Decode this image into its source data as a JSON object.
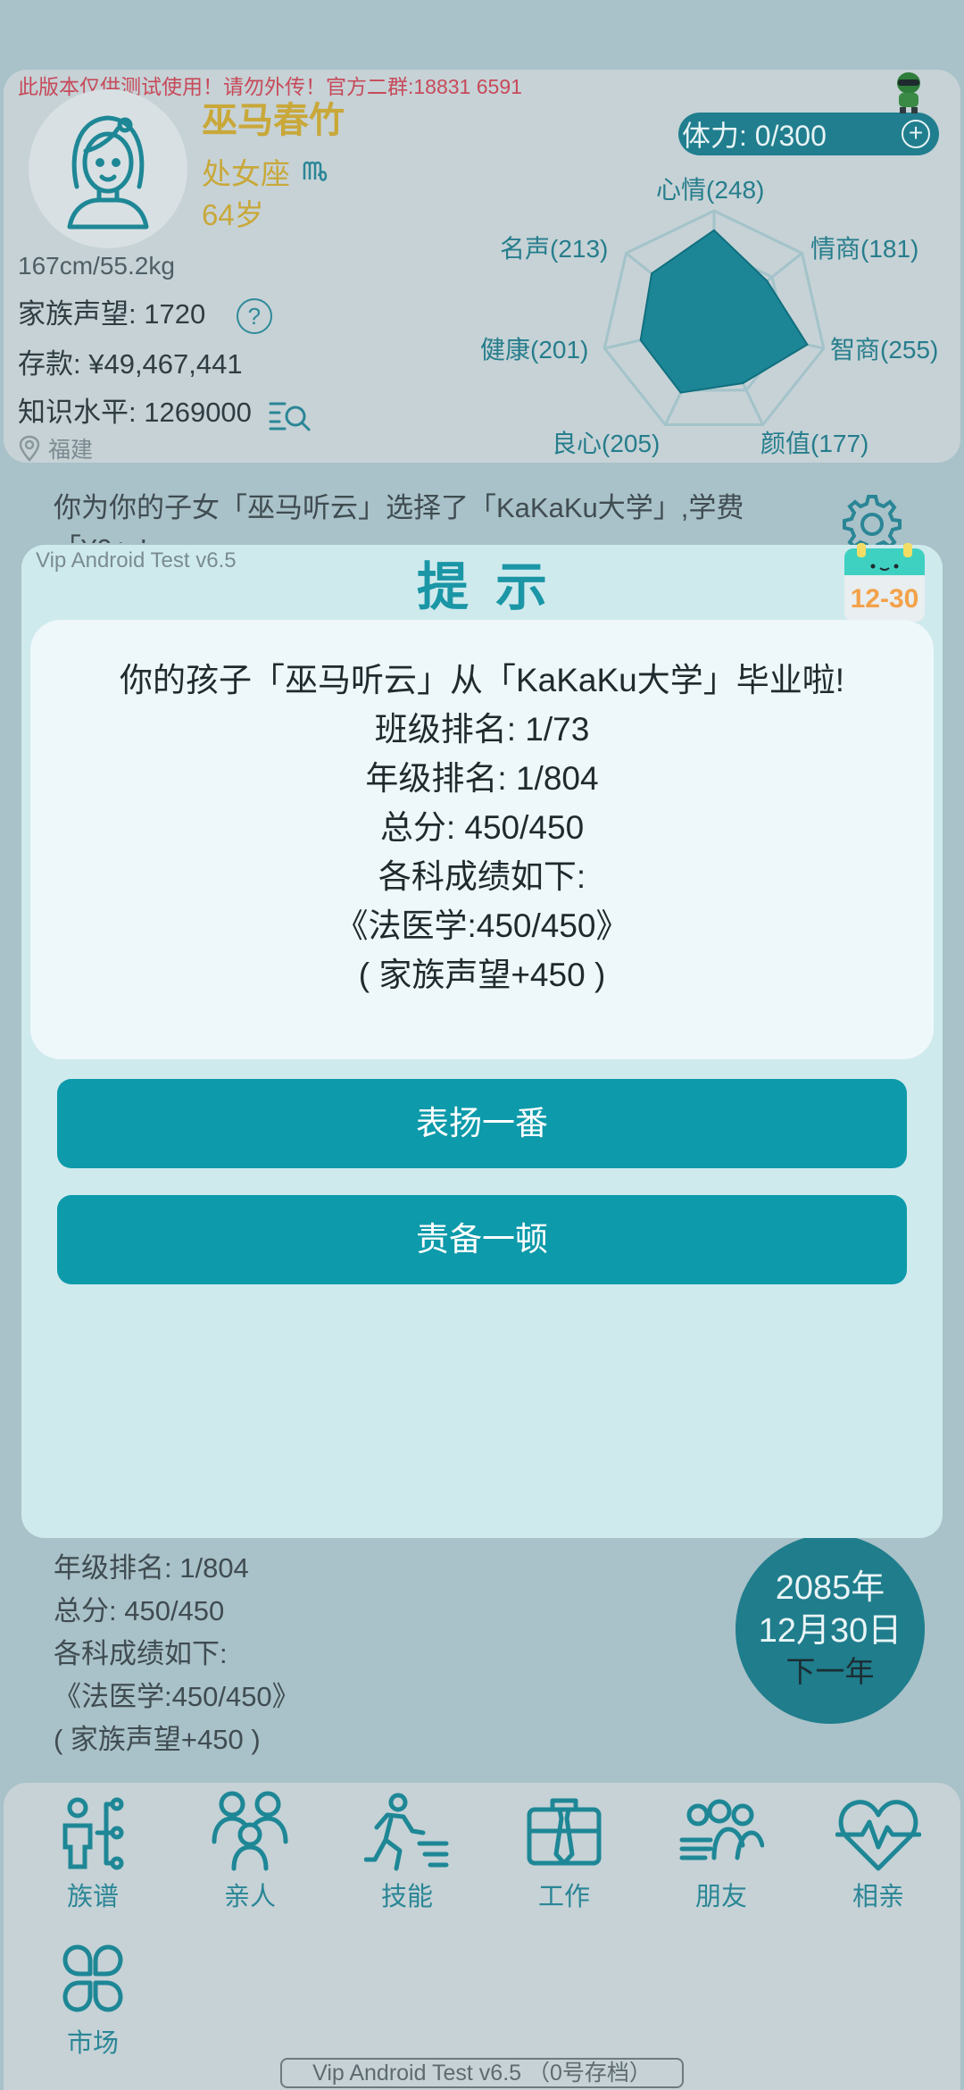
{
  "profile": {
    "warning": "此版本仅供测试使用！请勿外传！官方二群:18831 6591",
    "name": "巫马春竹",
    "zodiac": "处女座",
    "age": "64岁",
    "height_weight": "167cm/55.2kg",
    "reputation_label": "家族声望: 1720",
    "help_icon": "?",
    "savings_label": "存款: ¥49,467,441",
    "knowledge_label": "知识水平: 1269000",
    "location": "福建",
    "stamina": "体力: 0/300",
    "stamina_plus": "+"
  },
  "radar": {
    "labels": {
      "mood": "心情(248)",
      "eq": "情商(181)",
      "iq": "智商(255)",
      "looks": "颜值(177)",
      "conscience": "良心(205)",
      "health": "健康(201)",
      "fame": "名声(213)"
    },
    "values": [
      248,
      181,
      255,
      177,
      205,
      201,
      213
    ],
    "max": 300,
    "fill_color": "#1d8696"
  },
  "feed": {
    "top_text": "你为你的子女「巫马听云」选择了「KaKaKu大学」,学费「¥0」!",
    "bottom_lines": [
      "年级排名: 1/804",
      "总分: 450/450",
      "各科成绩如下:",
      "《法医学:450/450》",
      "( 家族声望+450 )"
    ]
  },
  "date": {
    "year": "2085年",
    "day": "12月30日",
    "next": "下一年"
  },
  "dialog": {
    "version": "Vip Android Test v6.5",
    "title": "提示",
    "calendar_badge": "12-30",
    "lines": [
      "你的孩子「巫马听云」从「KaKaKu大学」毕业啦!",
      "班级排名: 1/73",
      "年级排名: 1/804",
      "总分: 450/450",
      "各科成绩如下:",
      "《法医学:450/450》",
      "( 家族声望+450 )"
    ],
    "praise_button": "表扬一番",
    "scold_button": "责备一顿"
  },
  "nav": {
    "items": [
      {
        "label": "族谱",
        "icon": "family-tree-icon"
      },
      {
        "label": "亲人",
        "icon": "relatives-icon"
      },
      {
        "label": "技能",
        "icon": "skills-icon"
      },
      {
        "label": "工作",
        "icon": "briefcase-icon"
      },
      {
        "label": "朋友",
        "icon": "friends-icon"
      },
      {
        "label": "相亲",
        "icon": "heartbeat-icon"
      },
      {
        "label": "市场",
        "icon": "market-icon"
      }
    ]
  },
  "footer": {
    "save_indicator": "Vip Android Test v6.5 （0号存档）"
  },
  "colors": {
    "accent": "#0d9aaa",
    "teal_dark": "#1f7d8c",
    "gold": "#c9a83a",
    "warning": "#c74a5a"
  }
}
